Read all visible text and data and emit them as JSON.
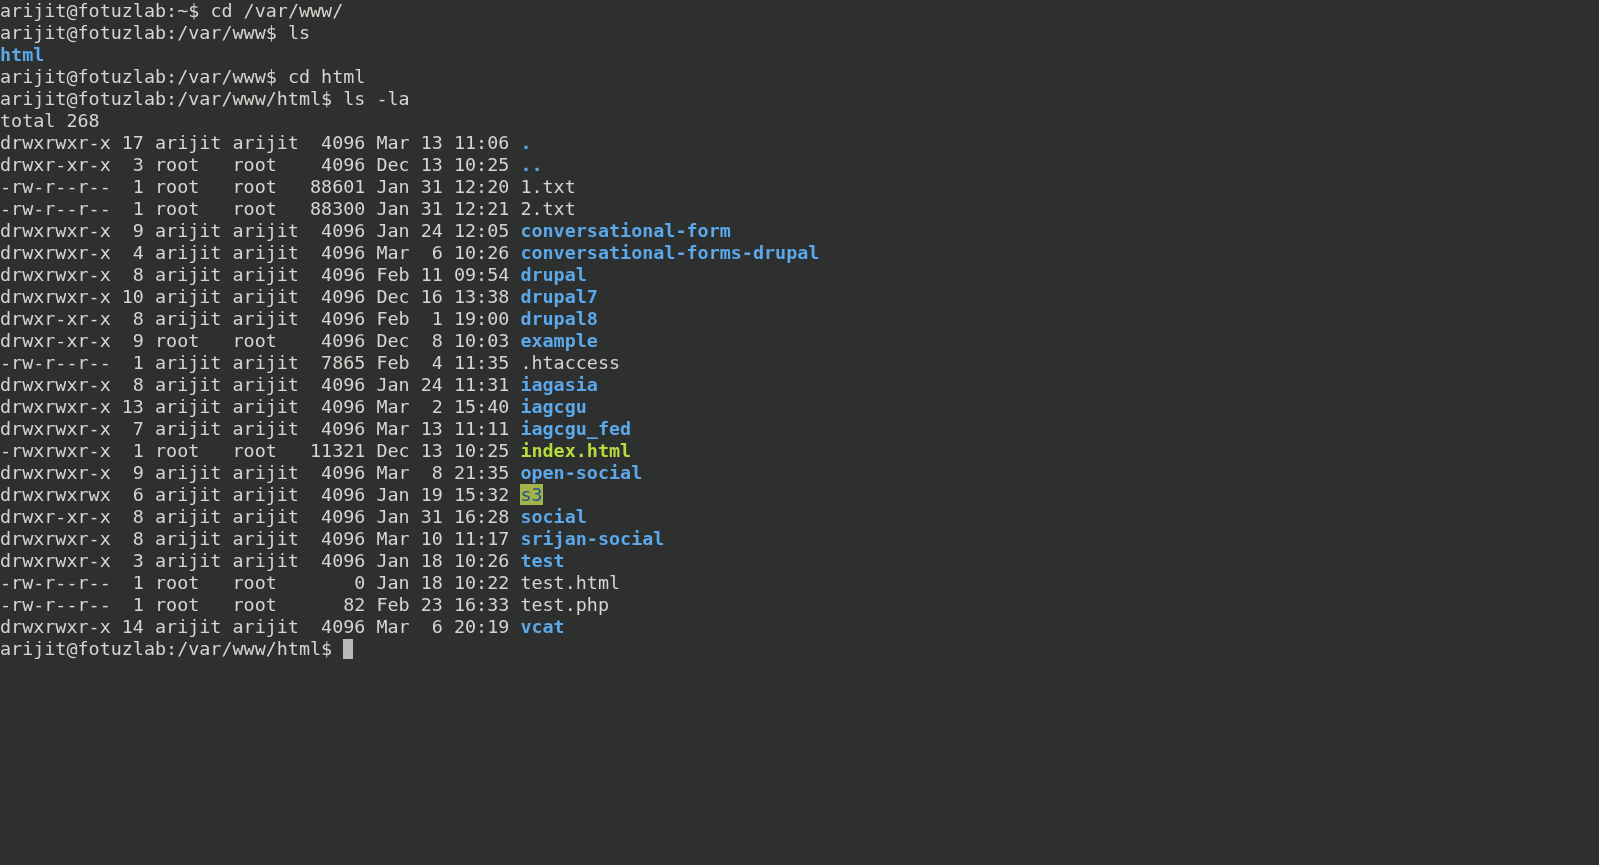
{
  "terminal": {
    "lines": [
      {
        "kind": "command",
        "prompt": "arijit@fotuzlab:~$",
        "command": "cd /var/www/"
      },
      {
        "kind": "command",
        "prompt": "arijit@fotuzlab:/var/www$",
        "command": "ls"
      },
      {
        "kind": "names",
        "entries": [
          {
            "name": "html",
            "kind": "dir"
          }
        ]
      },
      {
        "kind": "command",
        "prompt": "arijit@fotuzlab:/var/www$",
        "command": "cd html"
      },
      {
        "kind": "command",
        "prompt": "arijit@fotuzlab:/var/www/html$",
        "command": "ls -la"
      },
      {
        "kind": "text",
        "text": "total 268"
      },
      {
        "kind": "listing",
        "rows": [
          {
            "info": "drwxrwxr-x 17 arijit arijit  4096 Mar 13 11:06",
            "name": ".",
            "kind": "dir"
          },
          {
            "info": "drwxr-xr-x  3 root   root    4096 Dec 13 10:25",
            "name": "..",
            "kind": "dir"
          },
          {
            "info": "-rw-r--r--  1 root   root   88601 Jan 31 12:20",
            "name": "1.txt",
            "kind": "file"
          },
          {
            "info": "-rw-r--r--  1 root   root   88300 Jan 31 12:21",
            "name": "2.txt",
            "kind": "file"
          },
          {
            "info": "drwxrwxr-x  9 arijit arijit  4096 Jan 24 12:05",
            "name": "conversational-form",
            "kind": "dir"
          },
          {
            "info": "drwxrwxr-x  4 arijit arijit  4096 Mar  6 10:26",
            "name": "conversational-forms-drupal",
            "kind": "dir"
          },
          {
            "info": "drwxrwxr-x  8 arijit arijit  4096 Feb 11 09:54",
            "name": "drupal",
            "kind": "dir"
          },
          {
            "info": "drwxrwxr-x 10 arijit arijit  4096 Dec 16 13:38",
            "name": "drupal7",
            "kind": "dir"
          },
          {
            "info": "drwxr-xr-x  8 arijit arijit  4096 Feb  1 19:00",
            "name": "drupal8",
            "kind": "dir"
          },
          {
            "info": "drwxr-xr-x  9 root   root    4096 Dec  8 10:03",
            "name": "example",
            "kind": "dir"
          },
          {
            "info": "-rw-r--r--  1 arijit arijit  7865 Feb  4 11:35",
            "name": ".htaccess",
            "kind": "file"
          },
          {
            "info": "drwxrwxr-x  8 arijit arijit  4096 Jan 24 11:31",
            "name": "iagasia",
            "kind": "dir"
          },
          {
            "info": "drwxrwxr-x 13 arijit arijit  4096 Mar  2 15:40",
            "name": "iagcgu",
            "kind": "dir"
          },
          {
            "info": "drwxrwxr-x  7 arijit arijit  4096 Mar 13 11:11",
            "name": "iagcgu_fed",
            "kind": "dir"
          },
          {
            "info": "-rwxrwxr-x  1 root   root   11321 Dec 13 10:25",
            "name": "index.html",
            "kind": "exec"
          },
          {
            "info": "drwxrwxr-x  9 arijit arijit  4096 Mar  8 21:35",
            "name": "open-social",
            "kind": "dir"
          },
          {
            "info": "drwxrwxrwx  6 arijit arijit  4096 Jan 19 15:32",
            "name": "s3",
            "kind": "world"
          },
          {
            "info": "drwxr-xr-x  8 arijit arijit  4096 Jan 31 16:28",
            "name": "social",
            "kind": "dir"
          },
          {
            "info": "drwxrwxr-x  8 arijit arijit  4096 Mar 10 11:17",
            "name": "srijan-social",
            "kind": "dir"
          },
          {
            "info": "drwxrwxr-x  3 arijit arijit  4096 Jan 18 10:26",
            "name": "test",
            "kind": "dir"
          },
          {
            "info": "-rw-r--r--  1 root   root       0 Jan 18 10:22",
            "name": "test.html",
            "kind": "file"
          },
          {
            "info": "-rw-r--r--  1 root   root      82 Feb 23 16:33",
            "name": "test.php",
            "kind": "file"
          },
          {
            "info": "drwxrwxr-x 14 arijit arijit  4096 Mar  6 20:19",
            "name": "vcat",
            "kind": "dir"
          }
        ]
      },
      {
        "kind": "prompt",
        "prompt": "arijit@fotuzlab:/var/www/html$"
      }
    ]
  }
}
